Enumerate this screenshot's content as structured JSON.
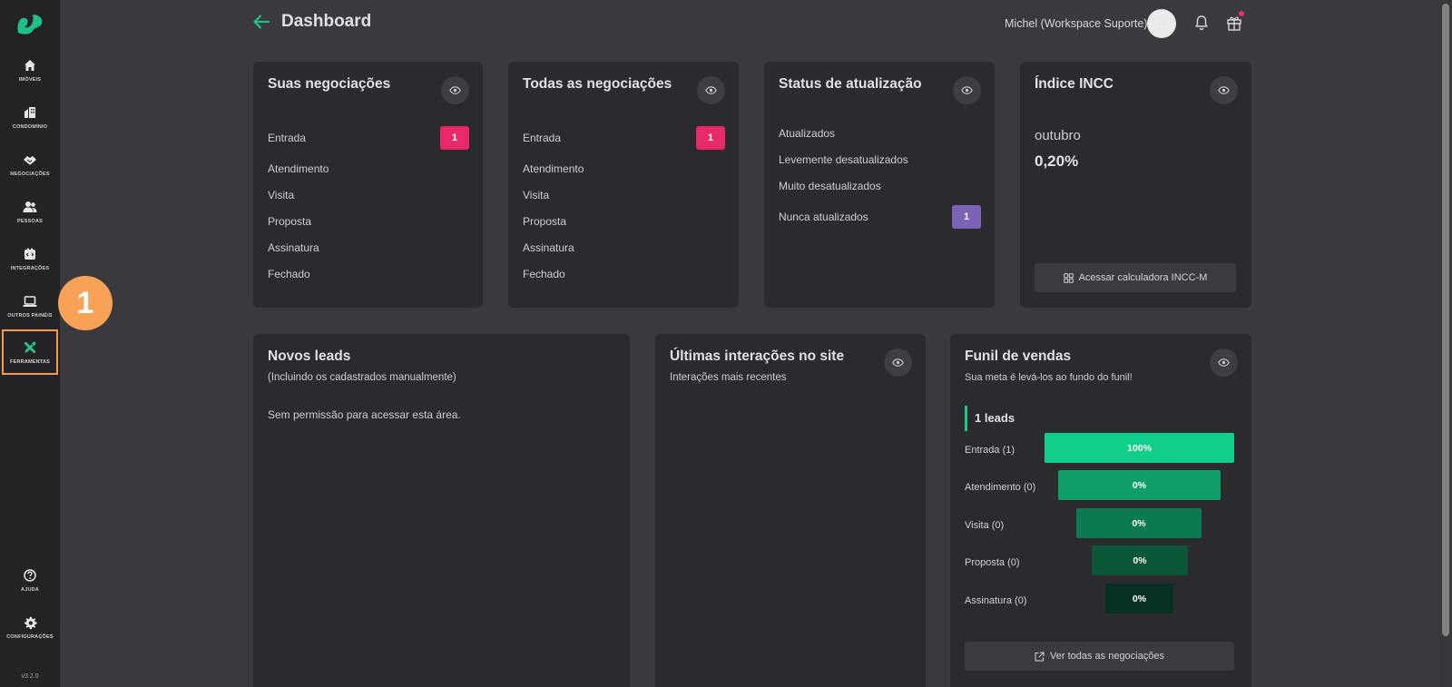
{
  "sidebar": {
    "items": [
      {
        "label": "IMÓVEIS",
        "icon": "home-icon"
      },
      {
        "label": "CONDOMÍNIO",
        "icon": "building-icon"
      },
      {
        "label": "NEGOCIAÇÕES",
        "icon": "handshake-icon"
      },
      {
        "label": "PESSOAS",
        "icon": "people-icon"
      },
      {
        "label": "INTEGRAÇÕES",
        "icon": "integration-icon"
      },
      {
        "label": "OUTROS PAINÉIS",
        "icon": "laptop-icon"
      },
      {
        "label": "FERRAMENTAS",
        "icon": "tools-icon"
      },
      {
        "label": "AJUDA",
        "icon": "help-icon"
      },
      {
        "label": "CONFIGURAÇÕES",
        "icon": "gear-icon"
      }
    ],
    "version": "v3.2.0",
    "active": "FERRAMENTAS"
  },
  "annotation": {
    "step": "1"
  },
  "header": {
    "title": "Dashboard",
    "user": "Michel (Workspace Suporte)",
    "avatar_text": "· ·"
  },
  "cards": {
    "suas": {
      "title": "Suas negociações",
      "rows": [
        "Entrada",
        "Atendimento",
        "Visita",
        "Proposta",
        "Assinatura",
        "Fechado"
      ],
      "entrada_count": "1"
    },
    "todas": {
      "title": "Todas as negociações",
      "rows": [
        "Entrada",
        "Atendimento",
        "Visita",
        "Proposta",
        "Assinatura",
        "Fechado"
      ],
      "entrada_count": "1"
    },
    "status": {
      "title": "Status de atualização",
      "rows": [
        "Atualizados",
        "Levemente desatualizados",
        "Muito desatualizados",
        "Nunca atualizados"
      ],
      "nunca_count": "1"
    },
    "incc": {
      "title": "Índice INCC",
      "month": "outubro",
      "value": "0,20%",
      "button": "Acessar calculadora INCC-M"
    },
    "leads": {
      "title": "Novos leads",
      "subtitle": "(Incluindo os cadastrados manualmente)",
      "message": "Sem permissão para acessar esta área."
    },
    "interacoes": {
      "title": "Últimas interações no site",
      "subtitle": "Interações mais recentes"
    },
    "funil": {
      "title": "Funil de vendas",
      "subtitle": "Sua meta é levá-los ao fundo do funil!",
      "leads_label": "1 leads",
      "stages": [
        {
          "label": "Entrada (1)",
          "value": "100%",
          "color": "#11cf8b"
        },
        {
          "label": "Atendimento (0)",
          "value": "0%",
          "color": "#0e9f69"
        },
        {
          "label": "Visita (0)",
          "value": "0%",
          "color": "#0b7a50"
        },
        {
          "label": "Proposta (0)",
          "value": "0%",
          "color": "#0a5637"
        },
        {
          "label": "Assinatura (0)",
          "value": "0%",
          "color": "#06301f"
        }
      ],
      "button": "Ver todas as negociações"
    }
  }
}
